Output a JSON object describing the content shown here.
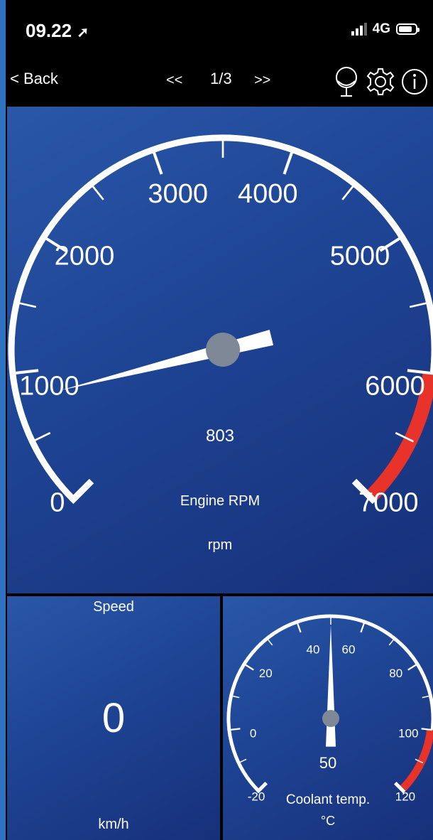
{
  "status_bar": {
    "time": "09.22",
    "network": "4G"
  },
  "nav": {
    "back_label": "< Back",
    "prev_label": "<<",
    "page_indicator": "1/3",
    "next_label": ">>"
  },
  "icons": [
    "dashboard-icon",
    "gear-icon",
    "info-icon",
    "location-arrow-icon"
  ],
  "rpm_gauge": {
    "title": "Engine RPM",
    "unit": "rpm",
    "value_display": "803",
    "value": 803,
    "min": 0,
    "max": 7000,
    "redline_start": 6000,
    "tick_labels": [
      "0",
      "1000",
      "2000",
      "3000",
      "4000",
      "5000",
      "6000",
      "7000"
    ]
  },
  "speed_gauge": {
    "title": "Speed",
    "value": "0",
    "unit": "km/h"
  },
  "coolant_gauge": {
    "title": "Coolant temp.",
    "unit": "°C",
    "value_display": "50",
    "value": 50,
    "min": -20,
    "max": 120,
    "redline_start": 100,
    "tick_labels": [
      "-20",
      "0",
      "20",
      "40",
      "60",
      "80",
      "100",
      "120"
    ]
  },
  "colors": {
    "panel_blue": "#1e4494",
    "redline": "#e8332a",
    "needle_hub": "#7f8896"
  }
}
